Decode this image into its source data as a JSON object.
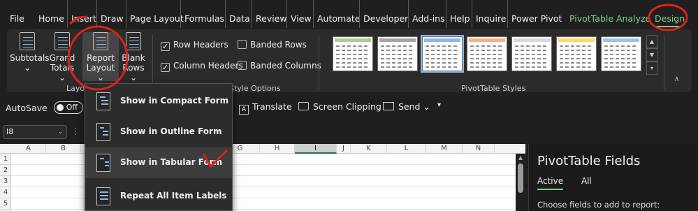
{
  "menu": {
    "tabs": [
      "File",
      "Home",
      "Insert",
      "Draw",
      "Page Layout",
      "Formulas",
      "Data",
      "Review",
      "View",
      "Automate",
      "Developer",
      "Add-ins",
      "Help",
      "Inquire",
      "Power Pivot",
      "PivotTable Analyze",
      "Design"
    ]
  },
  "ribbon": {
    "layout": {
      "subtotals": "Subtotals",
      "grand_totals_1": "Grand",
      "grand_totals_2": "Totals",
      "report_layout_1": "Report",
      "report_layout_2": "Layout",
      "blank_rows_1": "Blank",
      "blank_rows_2": "Rows",
      "group_label": "Layou"
    },
    "style_options": {
      "row_headers": "Row Headers",
      "column_headers": "Column Headers",
      "banded_rows": "Banded Rows",
      "banded_columns": "Banded Columns",
      "row_headers_checked": true,
      "column_headers_checked": true,
      "group_label": "Style Options"
    },
    "pivot_styles": {
      "group_label": "PivotTable Styles",
      "accent_colors": [
        "#a9d08e",
        "#a6a6a6",
        "#8fb8e8",
        "#f4b183",
        "#d9d9d9",
        "#ffd966",
        "#9dc3e6"
      ]
    }
  },
  "qat": {
    "autosave_label": "AutoSave",
    "autosave_state": "Off",
    "translate": "Translate",
    "screen_clipping": "Screen Clipping",
    "send": "Send"
  },
  "formula_bar": {
    "name_box": "I8"
  },
  "sheet": {
    "columns": [
      "A",
      "B",
      "C",
      "D",
      "E",
      "F",
      "G",
      "H",
      "I",
      "J",
      "K",
      "L",
      "M",
      "N"
    ],
    "rows": [
      "1",
      "2",
      "3",
      "4",
      "5"
    ]
  },
  "dropdown": {
    "items": [
      {
        "label": "Show in Compact Form"
      },
      {
        "label": "Show in Outline Form"
      },
      {
        "label": "Show in Tabular Form"
      },
      {
        "label": "Repeat All Item Labels"
      }
    ]
  },
  "pivot_panel": {
    "title": "PivotTable Fields",
    "tab_active": "Active",
    "tab_all": "All",
    "hint": "Choose fields to add to report:"
  },
  "colors": {
    "accent_green": "#7fcf8a",
    "annotation_red": "#e0201c"
  }
}
